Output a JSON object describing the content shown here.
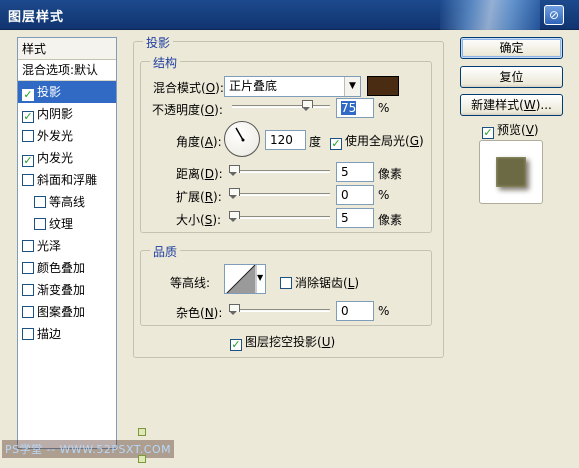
{
  "title": "图层样式",
  "close_glyph": "⊘",
  "styles_panel": {
    "header": "样式",
    "default_option": "混合选项:默认",
    "items": [
      {
        "label": "投影",
        "checked": true,
        "active": true,
        "sub": false
      },
      {
        "label": "内阴影",
        "checked": true,
        "active": false,
        "sub": false
      },
      {
        "label": "外发光",
        "checked": false,
        "active": false,
        "sub": false
      },
      {
        "label": "内发光",
        "checked": true,
        "active": false,
        "sub": false
      },
      {
        "label": "斜面和浮雕",
        "checked": false,
        "active": false,
        "sub": false
      },
      {
        "label": "等高线",
        "checked": false,
        "active": false,
        "sub": true
      },
      {
        "label": "纹理",
        "checked": false,
        "active": false,
        "sub": true
      },
      {
        "label": "光泽",
        "checked": false,
        "active": false,
        "sub": false
      },
      {
        "label": "颜色叠加",
        "checked": false,
        "active": false,
        "sub": false
      },
      {
        "label": "渐变叠加",
        "checked": false,
        "active": false,
        "sub": false
      },
      {
        "label": "图案叠加",
        "checked": false,
        "active": false,
        "sub": false
      },
      {
        "label": "描边",
        "checked": false,
        "active": false,
        "sub": false
      }
    ]
  },
  "drop_shadow": {
    "section_title": "投影",
    "structure": {
      "title": "结构",
      "blend_mode_label": "混合模式(",
      "blend_mode_key": "O",
      "blend_mode_value": "正片叠底",
      "shadow_color": "#4a2c12",
      "opacity_label": "不透明度(",
      "opacity_key": "O",
      "opacity_value": "75",
      "opacity_level": 75,
      "percent": "%",
      "angle_label": "角度(",
      "angle_key": "A",
      "angle_value": "120",
      "angle_deg": 120,
      "degree_unit": "度",
      "global_light_label": "使用全局光(",
      "global_light_key": "G",
      "global_light_checked": true,
      "distance_label": "距离(",
      "distance_key": "D",
      "distance_value": "5",
      "spread_label": "扩展(",
      "spread_key": "R",
      "spread_value": "0",
      "size_label": "大小(",
      "size_key": "S",
      "size_value": "5",
      "px_unit": "像素"
    },
    "quality": {
      "title": "品质",
      "contour_label": "等高线:",
      "antialias_label": "消除锯齿(",
      "antialias_key": "L",
      "antialias_checked": false,
      "noise_label": "杂色(",
      "noise_key": "N",
      "noise_value": "0",
      "knockout_label": "图层挖空投影(",
      "knockout_key": "U",
      "knockout_checked": true
    }
  },
  "buttons": {
    "ok": "确定",
    "reset": "复位",
    "new_style": "新建样式(",
    "new_style_key": "W",
    "new_style_suffix": ")..."
  },
  "preview": {
    "label": "预览(",
    "key": "V",
    "checked": true,
    "swatch_color": "#6b6a45"
  },
  "watermark": "PS学堂 -- WWW.52PSXT.COM"
}
